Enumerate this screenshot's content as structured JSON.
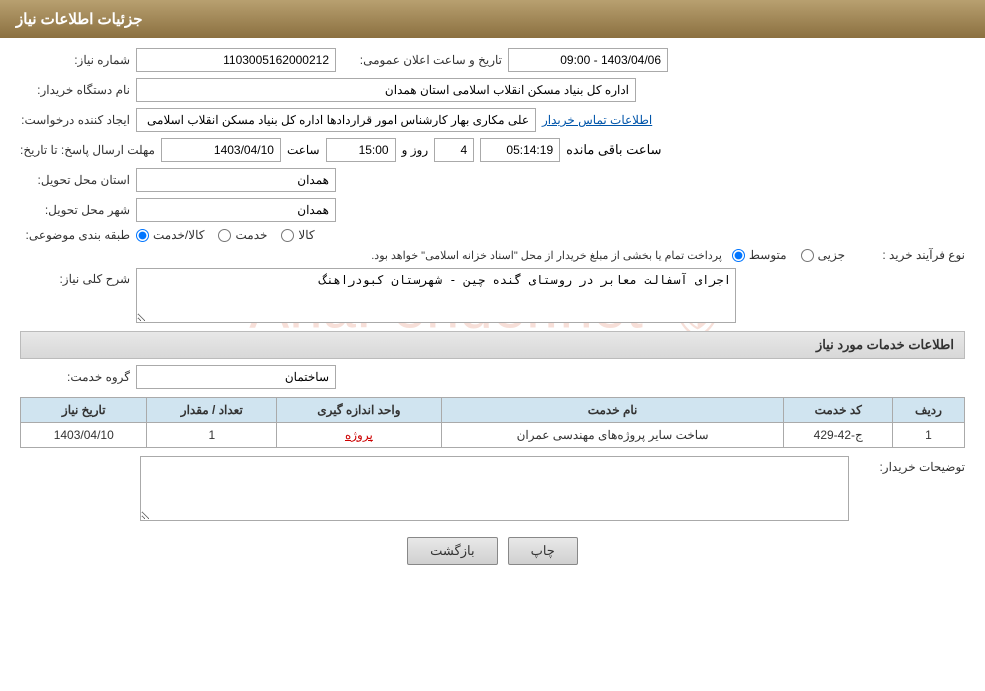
{
  "header": {
    "title": "جزئیات اطلاعات نیاز"
  },
  "form": {
    "need_number_label": "شماره نیاز:",
    "need_number_value": "1103005162000212",
    "announcement_date_label": "تاریخ و ساعت اعلان عمومی:",
    "announcement_date_value": "1403/04/06 - 09:00",
    "buyer_org_label": "نام دستگاه خریدار:",
    "buyer_org_value": "اداره کل بنیاد مسکن انقلاب اسلامی استان همدان",
    "creator_label": "ایجاد کننده درخواست:",
    "creator_value": "علی مکاری بهار کارشناس امور قراردادها اداره کل بنیاد مسکن انقلاب اسلامی",
    "creator_link": "اطلاعات تماس خریدار",
    "deadline_label": "مهلت ارسال پاسخ: تا تاریخ:",
    "deadline_date": "1403/04/10",
    "deadline_time_label": "ساعت",
    "deadline_time": "15:00",
    "deadline_days_label": "روز و",
    "deadline_days": "4",
    "deadline_remaining_label": "ساعت باقی مانده",
    "deadline_remaining": "05:14:19",
    "province_label": "استان محل تحویل:",
    "province_value": "همدان",
    "city_label": "شهر محل تحویل:",
    "city_value": "همدان",
    "category_label": "طبقه بندی موضوعی:",
    "category_option1": "کالا",
    "category_option2": "خدمت",
    "category_option3": "کالا/خدمت",
    "category_selected": "کالا/خدمت",
    "purchase_type_label": "نوع فرآیند خرید :",
    "purchase_type_option1": "جزیی",
    "purchase_type_option2": "متوسط",
    "purchase_type_note": "پرداخت تمام یا بخشی از مبلغ خریدار از محل \"اسناد خزانه اسلامی\" خواهد بود.",
    "description_label": "شرح کلی نیاز:",
    "description_value": "اجرای آسفالت معابر در روستای گنده چین - شهرستان کبودراهنگ",
    "services_section_title": "اطلاعات خدمات مورد نیاز",
    "service_group_label": "گروه خدمت:",
    "service_group_value": "ساختمان",
    "table": {
      "columns": [
        "ردیف",
        "کد خدمت",
        "نام خدمت",
        "واحد اندازه گیری",
        "تعداد / مقدار",
        "تاریخ نیاز"
      ],
      "rows": [
        {
          "row": "1",
          "code": "ج-42-429",
          "name": "ساخت سایر پروژه‌های مهندسی عمران",
          "unit": "پروژه",
          "quantity": "1",
          "date": "1403/04/10"
        }
      ]
    },
    "buyer_notes_label": "توضیحات خریدار:",
    "buyer_notes_value": "",
    "btn_print": "چاپ",
    "btn_back": "بازگشت"
  }
}
